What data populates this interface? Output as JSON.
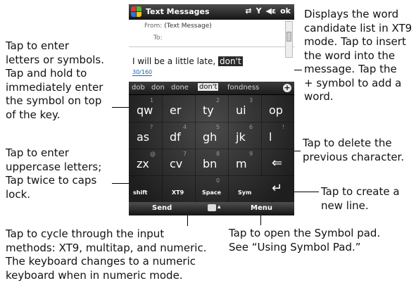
{
  "callouts": {
    "enter_letters": "Tap to enter\nletters or symbols.\nTap and hold to\nimmediately enter\nthe symbol on top\nof the key.",
    "uppercase": "Tap to enter\nuppercase letters;\nTap twice to caps\nlock.",
    "cycle_input": "Tap to cycle through the input\nmethods: XT9, multitap, and numeric.\nThe keyboard changes to a numeric\nkeyboard when in numeric mode.",
    "word_candidates": "Displays the word\ncandidate list in XT9\nmode. Tap to insert\nthe word into the\nmessage. Tap the\n+ symbol to add a\nword.",
    "delete_char": "Tap to delete the\nprevious character.",
    "new_line": "Tap to create a\nnew line.",
    "symbol_pad": "Tap to open the Symbol pad.\nSee “Using Symbol Pad.”"
  },
  "phone": {
    "title": "Text Messages",
    "status_ok": "ok",
    "from_label": "From:",
    "from_value": "(Text Message)",
    "to_label": "To:",
    "message_text": "I will be a little late,",
    "message_selected": "don't",
    "char_count": "30/160",
    "candidates": [
      "dob",
      "don",
      "done",
      "don't",
      "fondness"
    ],
    "plus_symbol": "+",
    "keys_row1": [
      {
        "letters": "qw",
        "top": "1"
      },
      {
        "letters": "er",
        "top": ""
      },
      {
        "letters": "ty",
        "top": "2"
      },
      {
        "letters": "ui",
        "top": "3"
      },
      {
        "letters": "op",
        "top": ""
      }
    ],
    "keys_row2": [
      {
        "letters": "as",
        "top": "?"
      },
      {
        "letters": "df",
        "top": "4"
      },
      {
        "letters": "gh",
        "top": "5"
      },
      {
        "letters": "jk",
        "top": "6"
      },
      {
        "letters": "l",
        "top": "!"
      }
    ],
    "keys_row3": [
      {
        "letters": "zx",
        "top": "@"
      },
      {
        "letters": "cv",
        "top": "7"
      },
      {
        "letters": "bn",
        "top": "8"
      },
      {
        "letters": "m",
        "top": "9"
      }
    ],
    "fn_keys": {
      "shift": "shift",
      "xt9": "XT9",
      "space": "Space",
      "sym": "Sym",
      "zero": "0"
    },
    "softkey_left": "Send",
    "softkey_right": "Menu",
    "colors": {
      "start_red": "#e8352b",
      "start_green": "#5cb531",
      "start_blue": "#2f74d0",
      "start_yellow": "#f5c518"
    }
  }
}
